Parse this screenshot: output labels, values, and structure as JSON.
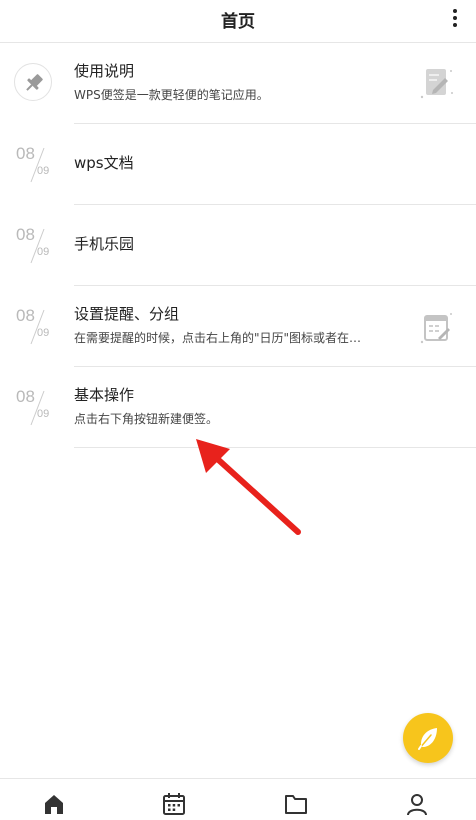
{
  "header": {
    "title": "首页",
    "more_icon": "more-vertical-icon"
  },
  "notes": [
    {
      "type": "pinned",
      "title": "使用说明",
      "subtitle": "WPS便签是一款更轻便的笔记应用。",
      "thumb": "note-edit-icon"
    },
    {
      "type": "dated",
      "month": "08",
      "day": "09",
      "title": "wps文档"
    },
    {
      "type": "dated",
      "month": "08",
      "day": "09",
      "title": "手机乐园"
    },
    {
      "type": "dated",
      "month": "08",
      "day": "09",
      "title": "设置提醒、分组",
      "subtitle": "在需要提醒的时候，点击右上角的\"日历\"图标或者在…",
      "thumb": "calendar-note-icon"
    },
    {
      "type": "dated",
      "month": "08",
      "day": "09",
      "title": "基本操作",
      "subtitle": "点击右下角按钮新建便签。"
    }
  ],
  "annotation": {
    "icon": "red-arrow-icon",
    "color": "#e8221c"
  },
  "fab": {
    "icon": "feather-icon",
    "color": "#f7c51c"
  },
  "bottom_nav": [
    {
      "icon": "home-icon",
      "active": true
    },
    {
      "icon": "calendar-icon",
      "active": false
    },
    {
      "icon": "folder-icon",
      "active": false
    },
    {
      "icon": "user-icon",
      "active": false
    }
  ]
}
